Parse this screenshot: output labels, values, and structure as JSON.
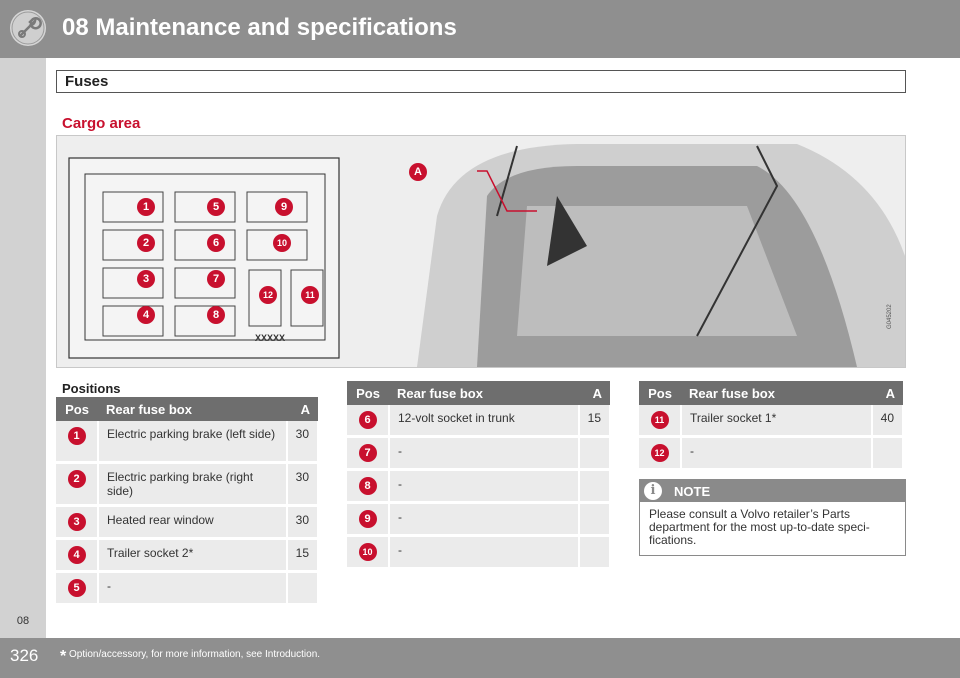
{
  "header": {
    "chapter_title": "08 Maintenance and specifications"
  },
  "sidebar": {
    "chapter_number": "08"
  },
  "section": {
    "title": "Fuses"
  },
  "subsection": {
    "title": "Cargo area"
  },
  "figure": {
    "id": "G045202",
    "callout_letter": "A",
    "fuse_numbers": [
      "1",
      "2",
      "3",
      "4",
      "5",
      "6",
      "7",
      "8",
      "9",
      "10",
      "11",
      "12"
    ],
    "box_label": "XXXXX"
  },
  "positions_heading": "Positions",
  "tables": [
    {
      "headers": {
        "pos": "Pos",
        "name": "Rear fuse box",
        "amp": "A"
      },
      "rows": [
        {
          "pos": "1",
          "name": "Electric parking brake (left side)",
          "amp": "30"
        },
        {
          "pos": "2",
          "name": "Electric parking brake (right side)",
          "amp": "30"
        },
        {
          "pos": "3",
          "name": "Heated rear window",
          "amp": "30"
        },
        {
          "pos": "4",
          "name": "Trailer socket 2*",
          "amp": "15"
        },
        {
          "pos": "5",
          "name": "-",
          "amp": ""
        }
      ]
    },
    {
      "headers": {
        "pos": "Pos",
        "name": "Rear fuse box",
        "amp": "A"
      },
      "rows": [
        {
          "pos": "6",
          "name": "12-volt socket in trunk",
          "amp": "15"
        },
        {
          "pos": "7",
          "name": "-",
          "amp": ""
        },
        {
          "pos": "8",
          "name": "-",
          "amp": ""
        },
        {
          "pos": "9",
          "name": "-",
          "amp": ""
        },
        {
          "pos": "10",
          "name": "-",
          "amp": ""
        }
      ]
    },
    {
      "headers": {
        "pos": "Pos",
        "name": "Rear fuse box",
        "amp": "A"
      },
      "rows": [
        {
          "pos": "11",
          "name": "Trailer socket 1*",
          "amp": "40"
        },
        {
          "pos": "12",
          "name": "-",
          "amp": ""
        }
      ]
    }
  ],
  "note": {
    "title": "NOTE",
    "text": "Please consult a Volvo retailer’s Parts department for the most up-to-date speci-fications."
  },
  "footer": {
    "page_number": "326",
    "asterisk": "*",
    "footnote": "Option/accessory, for more information, see Introduction."
  },
  "colors": {
    "accent": "#c8102e",
    "header_gray": "#8f8f8f",
    "table_header": "#6e6e6e",
    "cell_bg": "#ebebeb"
  }
}
